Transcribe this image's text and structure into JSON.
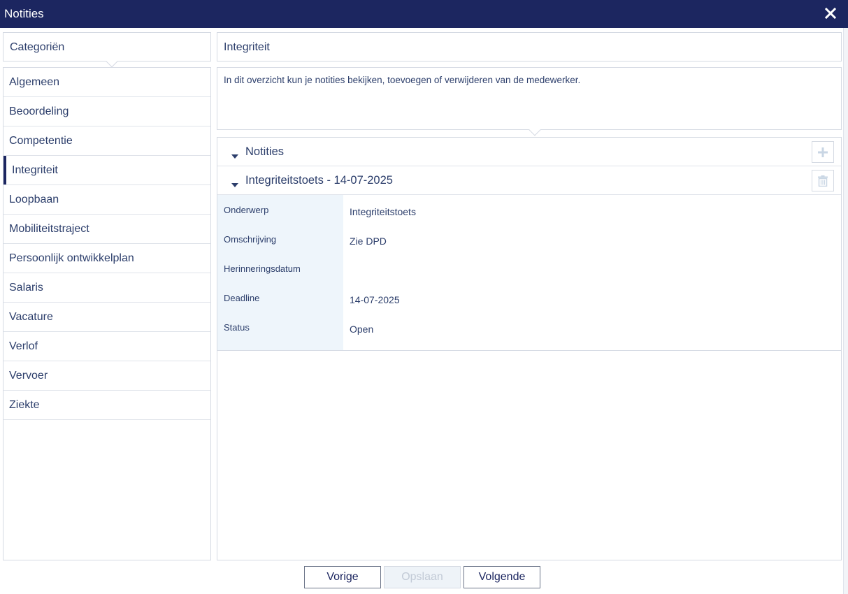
{
  "window": {
    "title": "Notities",
    "close_icon": "close-icon"
  },
  "categories": {
    "header": "Categoriën",
    "items": [
      {
        "label": "Algemeen",
        "active": false
      },
      {
        "label": "Beoordeling",
        "active": false
      },
      {
        "label": "Competentie",
        "active": false
      },
      {
        "label": "Integriteit",
        "active": true
      },
      {
        "label": "Loopbaan",
        "active": false
      },
      {
        "label": "Mobiliteitstraject",
        "active": false
      },
      {
        "label": "Persoonlijk ontwikkelplan",
        "active": false
      },
      {
        "label": "Salaris",
        "active": false
      },
      {
        "label": "Vacature",
        "active": false
      },
      {
        "label": "Verlof",
        "active": false
      },
      {
        "label": "Vervoer",
        "active": false
      },
      {
        "label": "Ziekte",
        "active": false
      }
    ]
  },
  "content": {
    "header": "Integriteit",
    "description": "In dit overzicht kun je notities bekijken, toevoegen of verwijderen van de medewerker.",
    "notes_section": {
      "label": "Notities",
      "add_icon": "plus-icon"
    },
    "note": {
      "title": "Integriteitstoets - 14-07-2025",
      "delete_icon": "trash-icon",
      "fields": [
        {
          "key": "Onderwerp",
          "value": "Integriteitstoets"
        },
        {
          "key": "Omschrijving",
          "value": "Zie DPD"
        },
        {
          "key": "Herinneringsdatum",
          "value": ""
        },
        {
          "key": "Deadline",
          "value": "14-07-2025"
        },
        {
          "key": "Status",
          "value": "Open"
        }
      ]
    }
  },
  "footer": {
    "previous": "Vorige",
    "save": "Opslaan",
    "save_disabled": true,
    "next": "Volgende"
  },
  "colors": {
    "titlebar": "#1c2660",
    "text": "#2c3e6b",
    "label_column": "#eef5fb",
    "active_indicator": "#1c2660",
    "icon_light": "#c9d6e4"
  }
}
